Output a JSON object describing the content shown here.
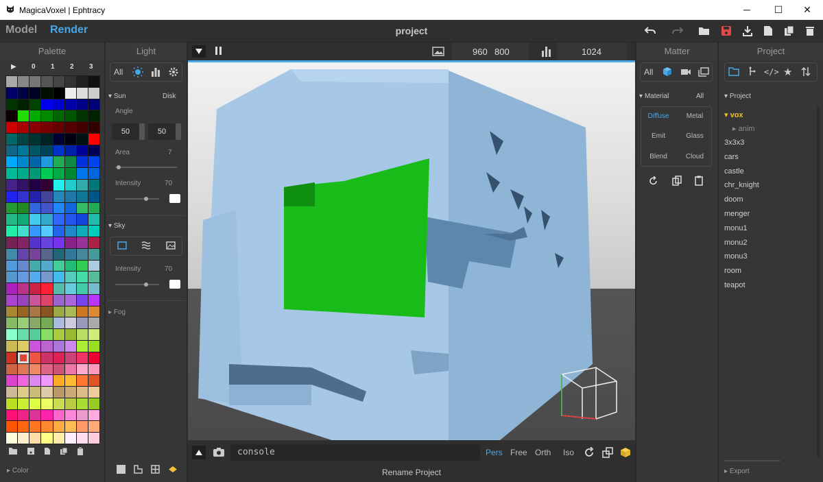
{
  "window": {
    "title": "MagicaVoxel | Ephtracy",
    "minimize": "─",
    "maximize": "☐",
    "close": "✕"
  },
  "menubar": {
    "model_tab": "Model",
    "render_tab": "Render",
    "project_title": "project",
    "toolbar_icons": [
      "undo-icon",
      "redo-icon",
      "open-folder-icon",
      "save-icon",
      "export-icon",
      "new-file-icon",
      "copy-icon",
      "delete-icon"
    ]
  },
  "palette": {
    "title": "Palette",
    "column_headers": [
      "▶",
      "0",
      "1",
      "2",
      "3"
    ],
    "color_label": "Color",
    "selected_index": 193,
    "colors": [
      "#a8a8a8",
      "#888888",
      "#777777",
      "#555555",
      "#444444",
      "#333333",
      "#222222",
      "#111111",
      "#000066",
      "#000044",
      "#000022",
      "#001100",
      "#000000",
      "#eeeeee",
      "#dddddd",
      "#cccccc",
      "#003300",
      "#002200",
      "#004400",
      "#0000ee",
      "#0000cc",
      "#0000aa",
      "#000088",
      "#000077",
      "#110000",
      "#22dd00",
      "#00aa00",
      "#008800",
      "#006600",
      "#005500",
      "#003300",
      "#002200",
      "#cc0000",
      "#aa0000",
      "#880000",
      "#770000",
      "#660000",
      "#550000",
      "#440000",
      "#330000",
      "#006666",
      "#004444",
      "#003333",
      "#002222",
      "#000033",
      "#000011",
      "#001111",
      "#ff0000",
      "#116688",
      "#007799",
      "#005566",
      "#004455",
      "#0033cc",
      "#0022aa",
      "#000099",
      "#000055",
      "#00aaff",
      "#0088cc",
      "#0066aa",
      "#2299dd",
      "#22aa55",
      "#118844",
      "#0033dd",
      "#0044ee",
      "#00bb99",
      "#00aa88",
      "#009977",
      "#00cc55",
      "#00aa44",
      "#008833",
      "#0077ee",
      "#0066dd",
      "#442288",
      "#331166",
      "#220044",
      "#330033",
      "#22eeee",
      "#22cccc",
      "#33aaaa",
      "#007777",
      "#2222ee",
      "#3333cc",
      "#2222aa",
      "#444499",
      "#2288bb",
      "#2277aa",
      "#117799",
      "#005588",
      "#229933",
      "#228822",
      "#3366dd",
      "#4455cc",
      "#2288ff",
      "#1166dd",
      "#33bb66",
      "#22aa55",
      "#22bb88",
      "#11aa77",
      "#44ccee",
      "#33aacc",
      "#3366ff",
      "#2255ee",
      "#1144dd",
      "#22bbaa",
      "#22eeaa",
      "#44ddcc",
      "#3399ff",
      "#55ccff",
      "#2266ee",
      "#2288cc",
      "#11aabb",
      "#00ccbb",
      "#772255",
      "#882266",
      "#5533cc",
      "#6644dd",
      "#7733ee",
      "#882288",
      "#993399",
      "#aa2244",
      "#4488aa",
      "#6644aa",
      "#774499",
      "#556688",
      "#226677",
      "#337799",
      "#448899",
      "#449999",
      "#5599dd",
      "#6688cc",
      "#44aaaa",
      "#55aacc",
      "#44cc99",
      "#22bb77",
      "#33cc55",
      "#aaccdd",
      "#5599cc",
      "#6699dd",
      "#55aaee",
      "#7799cc",
      "#44bbee",
      "#55ccbb",
      "#44ddaa",
      "#55bb99",
      "#aa22bb",
      "#bb3388",
      "#cc2244",
      "#ff2233",
      "#55bbaa",
      "#66ccdd",
      "#44ccaa",
      "#77bbcc",
      "#aa44cc",
      "#9944bb",
      "#cc5599",
      "#dd4466",
      "#9966cc",
      "#aa66dd",
      "#7744ee",
      "#bb33ff",
      "#aa8833",
      "#996622",
      "#aa7744",
      "#885522",
      "#99aa44",
      "#aabb55",
      "#cc7722",
      "#dd8833",
      "#88bb66",
      "#99cc77",
      "#88aa66",
      "#77aa55",
      "#aabbdd",
      "#ccccdd",
      "#9999bb",
      "#aaaaaa",
      "#88ffcc",
      "#66ddaa",
      "#55cc99",
      "#88dd66",
      "#aacc44",
      "#99bb33",
      "#bbdd66",
      "#ccee77",
      "#ccbb55",
      "#ddcc66",
      "#cc55dd",
      "#bb66cc",
      "#aa77dd",
      "#cc88ee",
      "#aaee33",
      "#99dd22",
      "#cc3322",
      "#dd4433",
      "#ee5544",
      "#cc3366",
      "#dd2255",
      "#cc4477",
      "#ee3366",
      "#ee0033",
      "#cc6644",
      "#dd7755",
      "#ee8866",
      "#dd6688",
      "#cc5577",
      "#ee77aa",
      "#ffaacc",
      "#ff99bb",
      "#dd44cc",
      "#ee66dd",
      "#dd88ee",
      "#ee99ff",
      "#ffaa22",
      "#ffbb33",
      "#ff7733",
      "#dd5522",
      "#ccbb99",
      "#ddcc88",
      "#ccbb77",
      "#ddccaa",
      "#bb9966",
      "#ccaa77",
      "#ddbb88",
      "#eecc99",
      "#bbdd22",
      "#ccee33",
      "#ddff44",
      "#eeff66",
      "#ccdd55",
      "#bbcc44",
      "#aadd33",
      "#99cc22",
      "#ff1177",
      "#ee2288",
      "#dd3399",
      "#ff22aa",
      "#ff66cc",
      "#ff88dd",
      "#ee99cc",
      "#ffaadd",
      "#ff5500",
      "#ff6611",
      "#ff7722",
      "#ff8833",
      "#ffaa44",
      "#ffbb55",
      "#ff9966",
      "#ffaa77",
      "#ffffdd",
      "#ffeecc",
      "#ffddaa",
      "#ffff88",
      "#ffeeaa",
      "#ffeeff",
      "#ffddee",
      "#ffccdd"
    ]
  },
  "light": {
    "title": "Light",
    "tabs": [
      "All"
    ],
    "sun": {
      "label": "Sun",
      "mode": "Disk",
      "angle_label": "Angle",
      "angle1": "50",
      "angle2": "50",
      "area_label": "Area",
      "area_value": "7",
      "intensity_label": "Intensity",
      "intensity_value": "70"
    },
    "sky": {
      "label": "Sky",
      "intensity_label": "Intensity",
      "intensity_value": "70"
    },
    "fog": {
      "label": "Fog"
    }
  },
  "viewport": {
    "width": "960",
    "height": "800",
    "samples": "1024",
    "console_placeholder": "console",
    "views": [
      "Pers",
      "Free",
      "Orth",
      "Iso"
    ],
    "status": "Rename Project"
  },
  "matter": {
    "title": "Matter",
    "tab_all": "All",
    "section": "Material",
    "section_right": "All",
    "materials": [
      "Diffuse",
      "Metal",
      "Emit",
      "Glass",
      "Blend",
      "Cloud"
    ]
  },
  "project": {
    "title": "Project",
    "section": "Project",
    "export_label": "Export",
    "folder": "vox",
    "subfolder": "anim",
    "items": [
      "3x3x3",
      "cars",
      "castle",
      "chr_knight",
      "doom",
      "menger",
      "monu1",
      "monu2",
      "monu3",
      "room",
      "teapot"
    ]
  },
  "colors": {
    "accent": "#47a7e8",
    "save_red": "#e24a4a",
    "folder_yellow": "#f0c030"
  }
}
